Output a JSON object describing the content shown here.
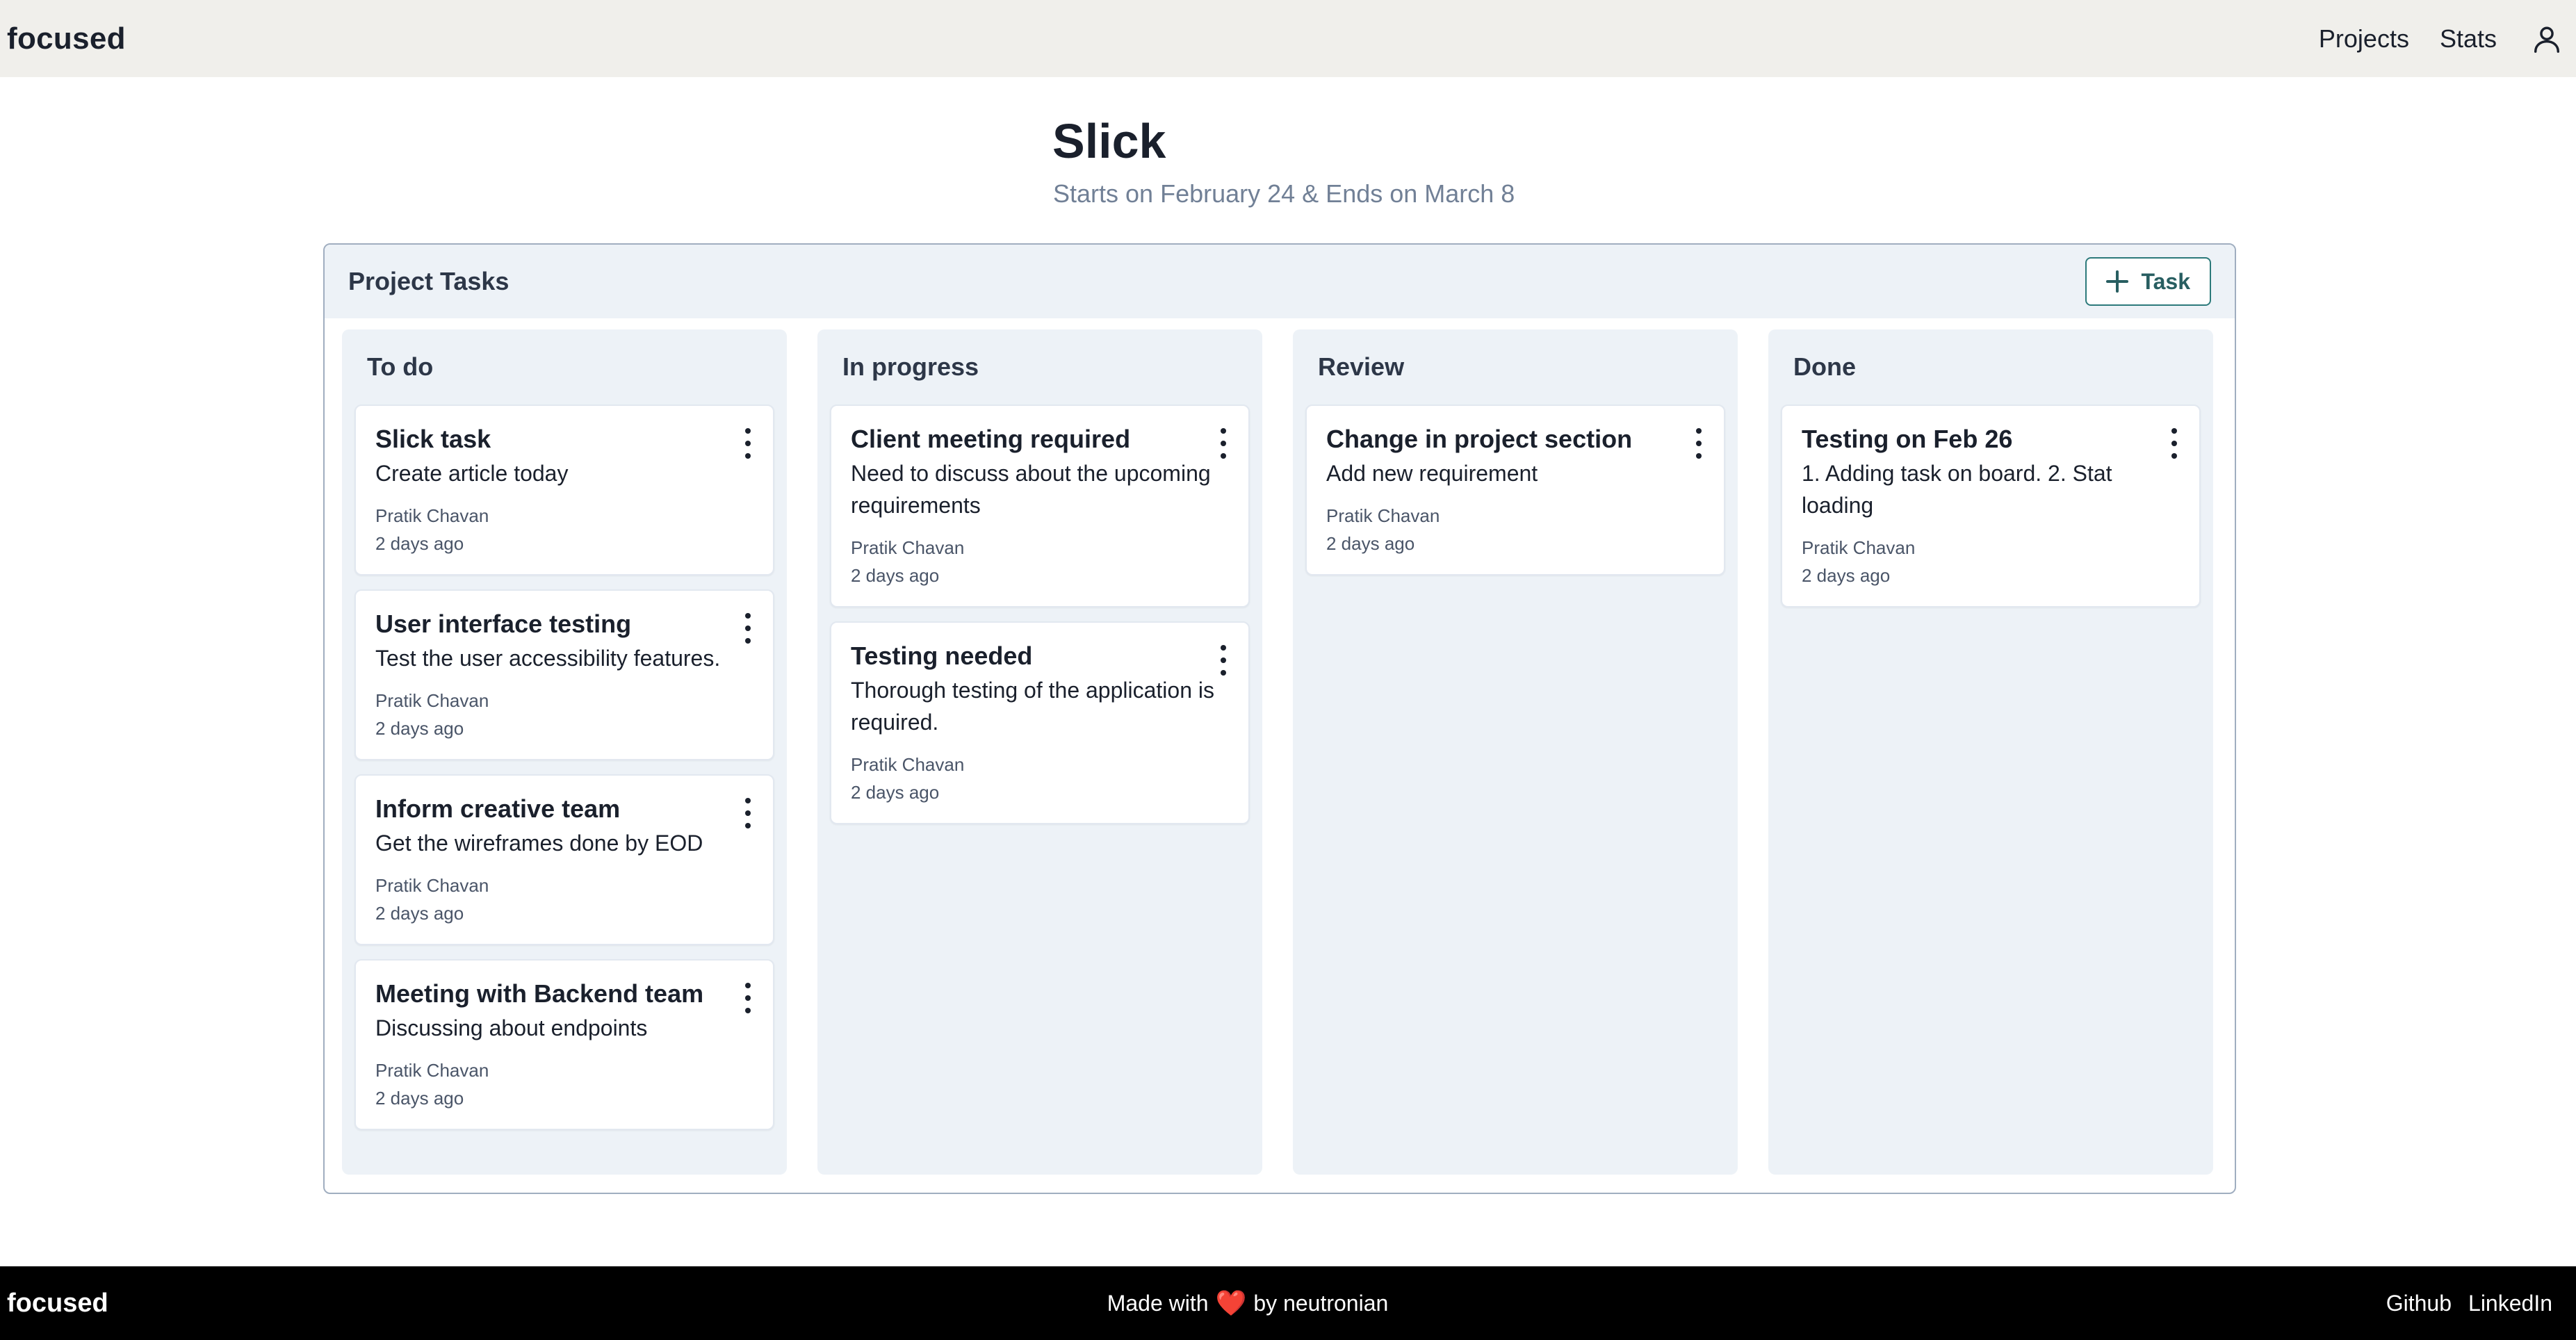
{
  "header": {
    "brand": "focused",
    "nav": {
      "projects": "Projects",
      "stats": "Stats"
    },
    "user_icon": "user-icon"
  },
  "project": {
    "title": "Slick",
    "dates": "Starts on February 24 & Ends on March 8"
  },
  "board": {
    "title": "Project Tasks",
    "add_button_label": "Task",
    "columns": [
      {
        "title": "To do",
        "cards": [
          {
            "title": "Slick task",
            "description": "Create article today",
            "author": "Pratik Chavan",
            "time": "2 days ago"
          },
          {
            "title": "User interface testing",
            "description": "Test the user accessibility features.",
            "author": "Pratik Chavan",
            "time": "2 days ago"
          },
          {
            "title": "Inform creative team",
            "description": "Get the wireframes done by EOD",
            "author": "Pratik Chavan",
            "time": "2 days ago"
          },
          {
            "title": "Meeting with Backend team",
            "description": "Discussing about endpoints",
            "author": "Pratik Chavan",
            "time": "2 days ago"
          }
        ]
      },
      {
        "title": "In progress",
        "cards": [
          {
            "title": "Client meeting required",
            "description": "Need to discuss about the upcoming requirements",
            "author": "Pratik Chavan",
            "time": "2 days ago"
          },
          {
            "title": "Testing needed",
            "description": "Thorough testing of the application is required.",
            "author": "Pratik Chavan",
            "time": "2 days ago"
          }
        ]
      },
      {
        "title": "Review",
        "cards": [
          {
            "title": "Change in project section",
            "description": "Add new requirement",
            "author": "Pratik Chavan",
            "time": "2 days ago"
          }
        ]
      },
      {
        "title": "Done",
        "cards": [
          {
            "title": "Testing on Feb 26",
            "description": "1. Adding task on board. 2. Stat loading",
            "author": "Pratik Chavan",
            "time": "2 days ago"
          }
        ]
      }
    ]
  },
  "footer": {
    "brand": "focused",
    "made_prefix": "Made with",
    "heart": "❤️",
    "made_suffix": "by neutronian",
    "links": {
      "github": "Github",
      "linkedin": "LinkedIn"
    }
  },
  "colors": {
    "header_bg": "#f0efeb",
    "footer_bg": "#000000",
    "column_bg": "#edf2f7",
    "accent": "#2c7a7b"
  }
}
